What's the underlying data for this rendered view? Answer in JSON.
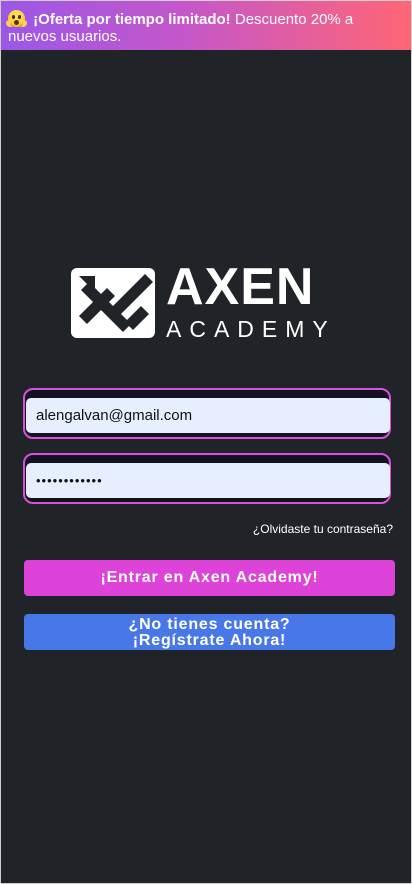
{
  "promo": {
    "emoji": "screaming-face-icon",
    "highlight": "¡Oferta por tiempo limitado!",
    "message": "Descuento 20% a nuevos usuarios."
  },
  "logo": {
    "brand": "AXEN",
    "subtitle": "ACADEMY"
  },
  "login": {
    "email_value": "alengalvan@gmail.com",
    "password_value": "••••••••••••",
    "forgot_label": "¿Olvidaste tu contraseña?",
    "submit_label": "¡Entrar en Axen Academy!",
    "register_line1": "¿No tienes cuenta?",
    "register_line2": "¡Regístrate Ahora!"
  },
  "colors": {
    "background": "#202327",
    "accent_pink": "#dd43d8",
    "accent_blue": "#4877e8",
    "field_bg": "#e6effd",
    "field_border": "#d94fe0"
  }
}
